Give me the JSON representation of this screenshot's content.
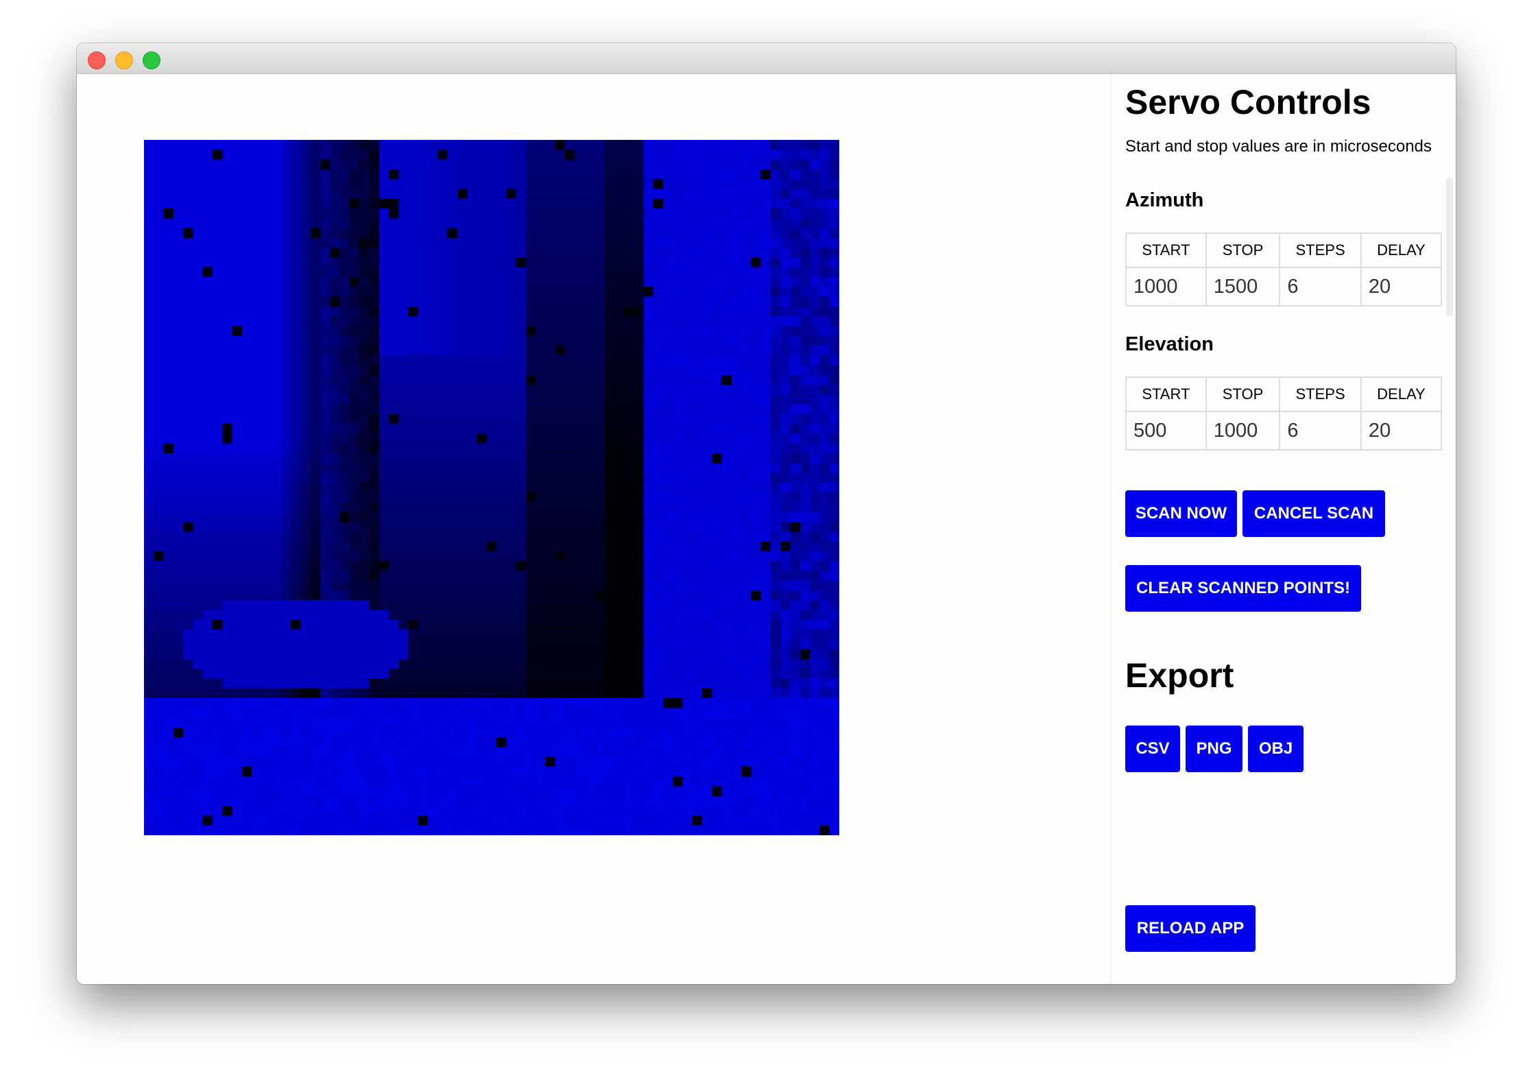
{
  "window": {
    "controls": [
      "close",
      "minimize",
      "zoom"
    ]
  },
  "scan": {
    "colormap": {
      "near": "#000000",
      "far": "#0000ee"
    }
  },
  "panel": {
    "title": "Servo Controls",
    "subtitle": "Start and stop values are in microseconds",
    "azimuth": {
      "title": "Azimuth",
      "headers": [
        "START",
        "STOP",
        "STEPS",
        "DELAY"
      ],
      "values": [
        "1000",
        "1500",
        "6",
        "20"
      ]
    },
    "elevation": {
      "title": "Elevation",
      "headers": [
        "START",
        "STOP",
        "STEPS",
        "DELAY"
      ],
      "values": [
        "500",
        "1000",
        "6",
        "20"
      ]
    },
    "buttons": {
      "scan_now": "SCAN NOW",
      "cancel_scan": "CANCEL SCAN",
      "clear_points": "CLEAR SCANNED POINTS!",
      "reload_app": "RELOAD APP"
    },
    "export": {
      "title": "Export",
      "csv": "CSV",
      "png": "PNG",
      "obj": "OBJ"
    },
    "accent": "#0000ee"
  }
}
